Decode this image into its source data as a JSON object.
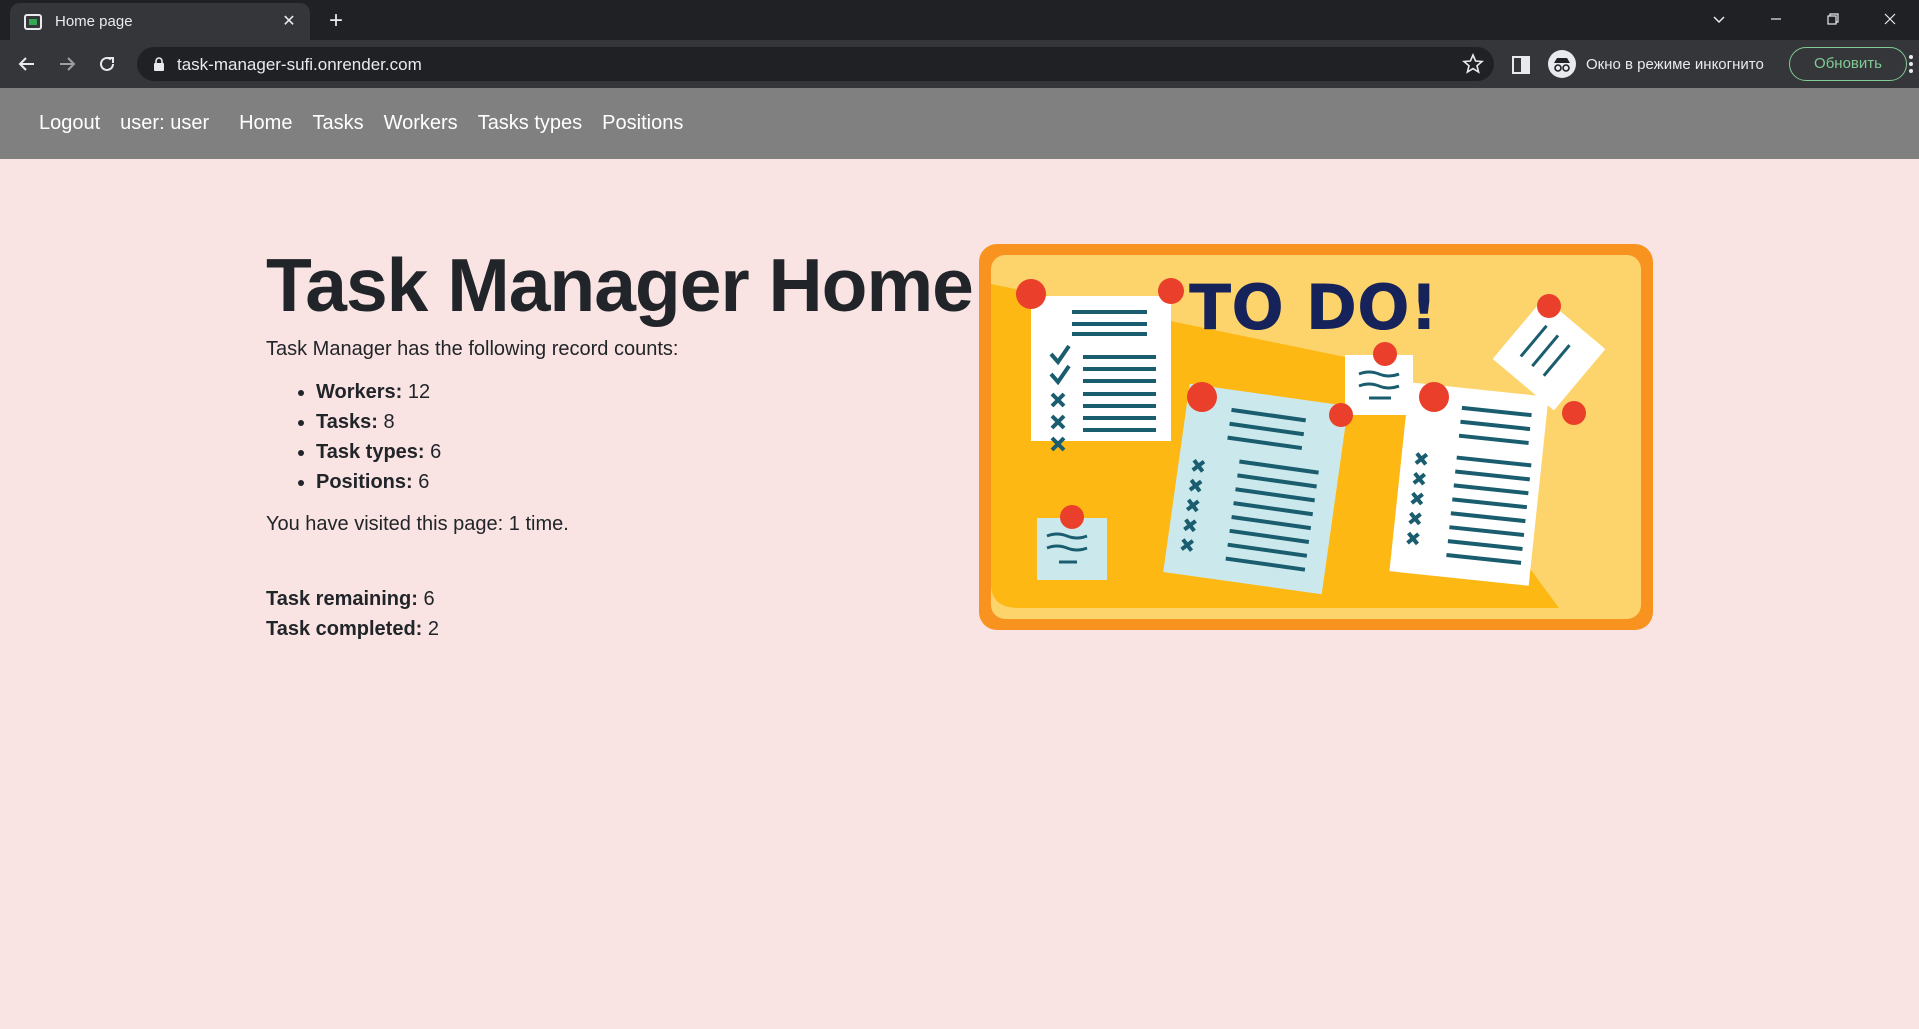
{
  "browser": {
    "tab_title": "Home page",
    "url": "task-manager-sufi.onrender.com",
    "incognito_label": "Окно в режиме инкогнито",
    "update_label": "Обновить",
    "icons": [
      "favicon-icon",
      "close-icon",
      "plus-icon",
      "chevron-down-icon",
      "minimize-icon",
      "restore-icon",
      "close-window-icon",
      "back-arrow-icon",
      "forward-arrow-icon",
      "reload-icon",
      "lock-icon",
      "star-icon",
      "side-panel-icon",
      "incognito-icon",
      "kebab-menu-icon"
    ]
  },
  "nav": {
    "logout": "Logout",
    "user": "user: user",
    "links": [
      "Home",
      "Tasks",
      "Workers",
      "Tasks types",
      "Positions"
    ]
  },
  "main": {
    "title": "Task Manager Home",
    "intro": "Task Manager has the following record counts:",
    "counts": [
      {
        "label": "Workers:",
        "value": "12"
      },
      {
        "label": "Tasks:",
        "value": "8"
      },
      {
        "label": "Task types:",
        "value": "6"
      },
      {
        "label": "Positions:",
        "value": "6"
      }
    ],
    "visits": "You have visited this page: 1 time.",
    "remaining_label": "Task remaining:",
    "remaining_value": "6",
    "completed_label": "Task completed:",
    "completed_value": "2"
  },
  "illustration": {
    "text": "TO DO!",
    "colors": {
      "frame": "#f7931e",
      "board": "#fdb813",
      "board_light": "#fdd36b",
      "pin": "#ea3f2b",
      "ink": "#1a5d6e",
      "heading": "#16235a"
    }
  }
}
